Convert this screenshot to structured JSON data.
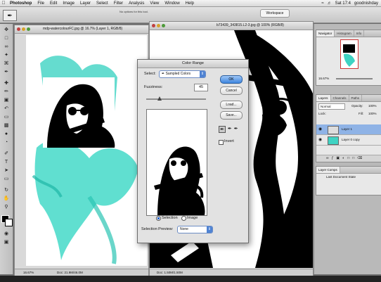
{
  "menubar": {
    "app": "Photoshop",
    "items": [
      "File",
      "Edit",
      "Image",
      "Layer",
      "Select",
      "Filter",
      "Analysis",
      "View",
      "Window",
      "Help"
    ],
    "clock": "Sat 17:4",
    "user": "goodnishday"
  },
  "options": {
    "message": "No options for this tool.",
    "workspace": "Workspace"
  },
  "doc1": {
    "title": "mdp-watercolourFC.jpg @ 16.7% (Layer 1, RGB/8)",
    "zoom": "16.67%",
    "status": "Doc: 21.9M/46.0M"
  },
  "doc2": {
    "title": "b73439_343815.L2-3.jpg @ 100% (RGB/8)",
    "status": "Doc: 1.50M/1.50M"
  },
  "color_range": {
    "title": "Color Range",
    "select_label": "Select:",
    "select_value": "Sampled Colors",
    "fuzziness_label": "Fuzziness:",
    "fuzziness_value": "45",
    "fuzziness_level": 0.22,
    "ok": "OK",
    "cancel": "Cancel",
    "load": "Load...",
    "save": "Save...",
    "invert": "Invert",
    "selection": "Selection",
    "image": "Image",
    "preview_label": "Selection Preview:",
    "preview_value": "None"
  },
  "panels": {
    "navigator_tabs": [
      "Navigator",
      "Histogram",
      "Info"
    ],
    "nav_zoom": "16.67%",
    "layers_tabs": [
      "Layers",
      "Channels",
      "Paths"
    ],
    "blend": "Normal",
    "opacity_label": "Opacity:",
    "opacity": "100%",
    "lock_label": "Lock:",
    "fill_label": "Fill:",
    "fill": "100%",
    "layers": [
      {
        "name": "Layer 1",
        "selected": true
      },
      {
        "name": "Layer 0 copy",
        "selected": false
      }
    ],
    "layercomps_tab": "Layer Comps",
    "layercomp_item": "Last Document State"
  },
  "colors": {
    "accent": "#3f86df",
    "teal": "#3fd3c3"
  }
}
